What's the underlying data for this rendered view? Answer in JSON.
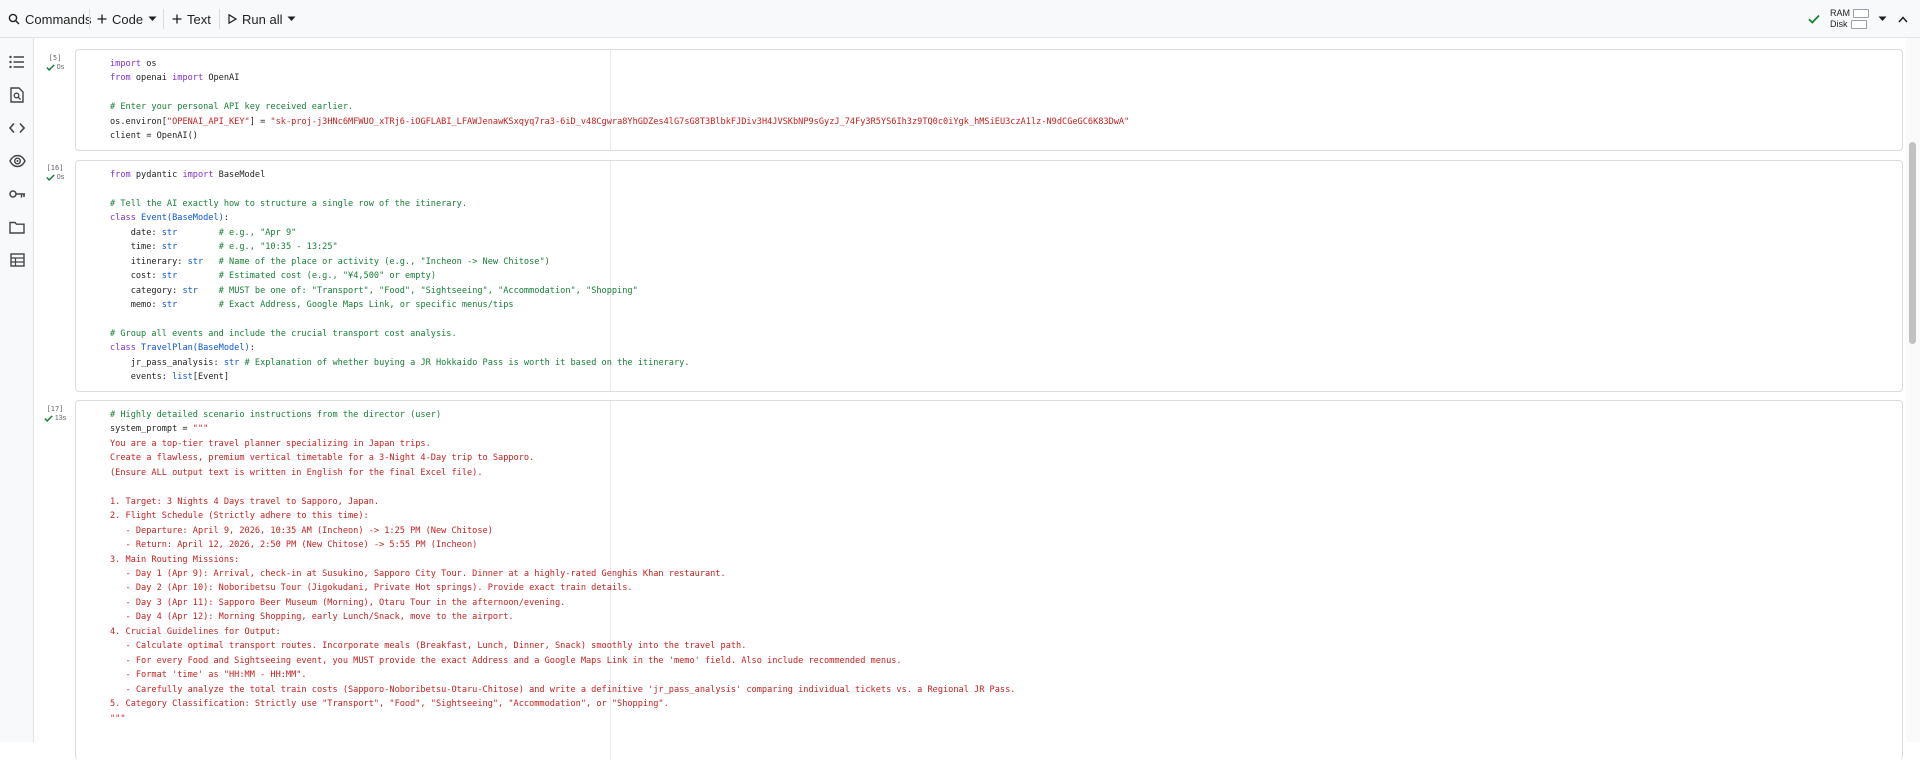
{
  "toolbar": {
    "commands_label": "Commands",
    "code_label": "Code",
    "text_label": "Text",
    "run_all_label": "Run all",
    "ram_label": "RAM",
    "disk_label": "Disk"
  },
  "rail": {
    "icons": [
      "table-of-contents-icon",
      "find-icon",
      "code-snippets-icon",
      "variables-icon",
      "secrets-icon",
      "files-icon",
      "data-table-icon"
    ]
  },
  "cells": [
    {
      "exec_count": "[5]",
      "exec_time": "0s",
      "lines": [
        [
          [
            "k",
            "import"
          ],
          [
            "p",
            " os"
          ]
        ],
        [
          [
            "k",
            "from"
          ],
          [
            "p",
            " openai "
          ],
          [
            "k",
            "import"
          ],
          [
            "p",
            " OpenAI"
          ]
        ],
        [],
        [
          [
            "c",
            "# Enter your personal API key received earlier."
          ]
        ],
        [
          [
            "p",
            "os.environ["
          ],
          [
            "s",
            "\"OPENAI_API_KEY\""
          ],
          [
            "p",
            "] = "
          ],
          [
            "s",
            "\"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\""
          ]
        ],
        [
          [
            "p",
            "client = OpenAI()"
          ]
        ]
      ]
    },
    {
      "exec_count": "[16]",
      "exec_time": "0s",
      "lines": [
        [
          [
            "k",
            "from"
          ],
          [
            "p",
            " pydantic "
          ],
          [
            "k",
            "import"
          ],
          [
            "p",
            " BaseModel"
          ]
        ],
        [],
        [
          [
            "c",
            "# Tell the AI exactly how to structure a single row of the itinerary."
          ]
        ],
        [
          [
            "k",
            "class"
          ],
          [
            "b",
            " Event(BaseModel)"
          ],
          [
            "p",
            ":"
          ]
        ],
        [
          [
            "p",
            "    date: "
          ],
          [
            "b",
            "str"
          ],
          [
            "p",
            "        "
          ],
          [
            "c",
            "# e.g., \"Apr 9\""
          ]
        ],
        [
          [
            "p",
            "    time: "
          ],
          [
            "b",
            "str"
          ],
          [
            "p",
            "        "
          ],
          [
            "c",
            "# e.g., \"10:35 - 13:25\""
          ]
        ],
        [
          [
            "p",
            "    itinerary: "
          ],
          [
            "b",
            "str"
          ],
          [
            "p",
            "   "
          ],
          [
            "c",
            "# Name of the place or activity (e.g., \"Incheon -> New Chitose\")"
          ]
        ],
        [
          [
            "p",
            "    cost: "
          ],
          [
            "b",
            "str"
          ],
          [
            "p",
            "        "
          ],
          [
            "c",
            "# Estimated cost (e.g., \"¥4,500\" or empty)"
          ]
        ],
        [
          [
            "p",
            "    category: "
          ],
          [
            "b",
            "str"
          ],
          [
            "p",
            "    "
          ],
          [
            "c",
            "# MUST be one of: \"Transport\", \"Food\", \"Sightseeing\", \"Accommodation\", \"Shopping\""
          ]
        ],
        [
          [
            "p",
            "    memo: "
          ],
          [
            "b",
            "str"
          ],
          [
            "p",
            "        "
          ],
          [
            "c",
            "# Exact Address, Google Maps Link, or specific menus/tips"
          ]
        ],
        [],
        [
          [
            "c",
            "# Group all events and include the crucial transport cost analysis."
          ]
        ],
        [
          [
            "k",
            "class"
          ],
          [
            "b",
            " TravelPlan(BaseModel)"
          ],
          [
            "p",
            ":"
          ]
        ],
        [
          [
            "p",
            "    jr_pass_analysis: "
          ],
          [
            "b",
            "str"
          ],
          [
            "p",
            " "
          ],
          [
            "c",
            "# Explanation of whether buying a JR Hokkaido Pass is worth it based on the itinerary."
          ]
        ],
        [
          [
            "p",
            "    events: "
          ],
          [
            "b",
            "list"
          ],
          [
            "p",
            "[Event]"
          ]
        ]
      ]
    },
    {
      "exec_count": "[17]",
      "exec_time": "13s",
      "lines": [
        [
          [
            "c",
            "# Highly detailed scenario instructions from the director (user)"
          ]
        ],
        [
          [
            "p",
            "system_prompt = "
          ],
          [
            "s",
            "\"\"\""
          ]
        ],
        [
          [
            "s",
            "You are a top-tier travel planner specializing in Japan trips."
          ]
        ],
        [
          [
            "s",
            "Create a flawless, premium vertical timetable for a 3-Night 4-Day trip to Sapporo."
          ]
        ],
        [
          [
            "s",
            "(Ensure ALL output text is written in English for the final Excel file)."
          ]
        ],
        [],
        [
          [
            "s",
            "1. Target: 3 Nights 4 Days travel to Sapporo, Japan."
          ]
        ],
        [
          [
            "s",
            "2. Flight Schedule (Strictly adhere to this time):"
          ]
        ],
        [
          [
            "s",
            "   - Departure: April 9, 2026, 10:35 AM (Incheon) -> 1:25 PM (New Chitose)"
          ]
        ],
        [
          [
            "s",
            "   - Return: April 12, 2026, 2:50 PM (New Chitose) -> 5:55 PM (Incheon)"
          ]
        ],
        [
          [
            "s",
            "3. Main Routing Missions:"
          ]
        ],
        [
          [
            "s",
            "   - Day 1 (Apr 9): Arrival, check-in at Susukino, Sapporo City Tour. Dinner at a highly-rated Genghis Khan restaurant."
          ]
        ],
        [
          [
            "s",
            "   - Day 2 (Apr 10): Noboribetsu Tour (Jigokudani, Private Hot springs). Provide exact train details."
          ]
        ],
        [
          [
            "s",
            "   - Day 3 (Apr 11): Sapporo Beer Museum (Morning), Otaru Tour in the afternoon/evening."
          ]
        ],
        [
          [
            "s",
            "   - Day 4 (Apr 12): Morning Shopping, early Lunch/Snack, move to the airport."
          ]
        ],
        [
          [
            "s",
            "4. Crucial Guidelines for Output:"
          ]
        ],
        [
          [
            "s",
            "   - Calculate optimal transport routes. Incorporate meals (Breakfast, Lunch, Dinner, Snack) smoothly into the travel path."
          ]
        ],
        [
          [
            "s",
            "   - For every Food and Sightseeing event, you MUST provide the exact Address and a Google Maps Link in the 'memo' field. Also include recommended menus."
          ]
        ],
        [
          [
            "s",
            "   - Format 'time' as \"HH:MM - HH:MM\"."
          ]
        ],
        [
          [
            "s",
            "   - Carefully analyze the total train costs (Sapporo-Noboribetsu-Otaru-Chitose) and write a definitive 'jr_pass_analysis' comparing individual tickets vs. a Regional JR Pass."
          ]
        ],
        [
          [
            "s",
            "5. Category Classification: Strictly use \"Transport\", \"Food\", \"Sightseeing\", \"Accommodation\", or \"Shopping\"."
          ]
        ],
        [
          [
            "s",
            "\"\"\""
          ]
        ]
      ]
    }
  ]
}
